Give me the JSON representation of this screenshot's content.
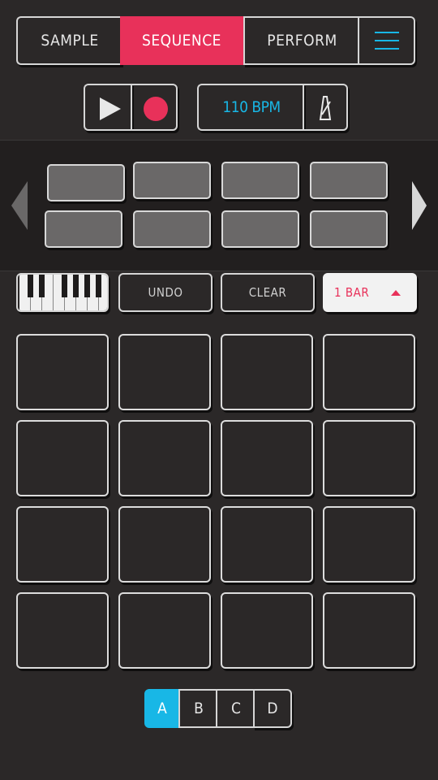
{
  "tabs": {
    "sample": "SAMPLE",
    "sequence": "SEQUENCE",
    "perform": "PERFORM",
    "active": "sequence"
  },
  "menu_icon": "hamburger-menu-icon",
  "transport": {
    "play_icon": "play-icon",
    "record_icon": "record-icon"
  },
  "tempo": {
    "bpm_label": "110 BPM",
    "metronome_icon": "metronome-icon"
  },
  "bank": {
    "prev_icon": "chevron-left-icon",
    "next_icon": "chevron-right-icon",
    "slot_count": 8
  },
  "toolbar": {
    "keyboard_icon": "piano-keyboard-icon",
    "undo": "UNDO",
    "clear": "CLEAR",
    "length": "1 BAR",
    "length_caret_icon": "caret-up-icon"
  },
  "grid": {
    "rows": 4,
    "cols": 4
  },
  "patterns": {
    "labels": [
      "A",
      "B",
      "C",
      "D"
    ],
    "active": "A"
  },
  "colors": {
    "background": "#2b2828",
    "accent_pink": "#e8315a",
    "accent_blue": "#18b7e6",
    "outline": "#d6d6d6"
  }
}
